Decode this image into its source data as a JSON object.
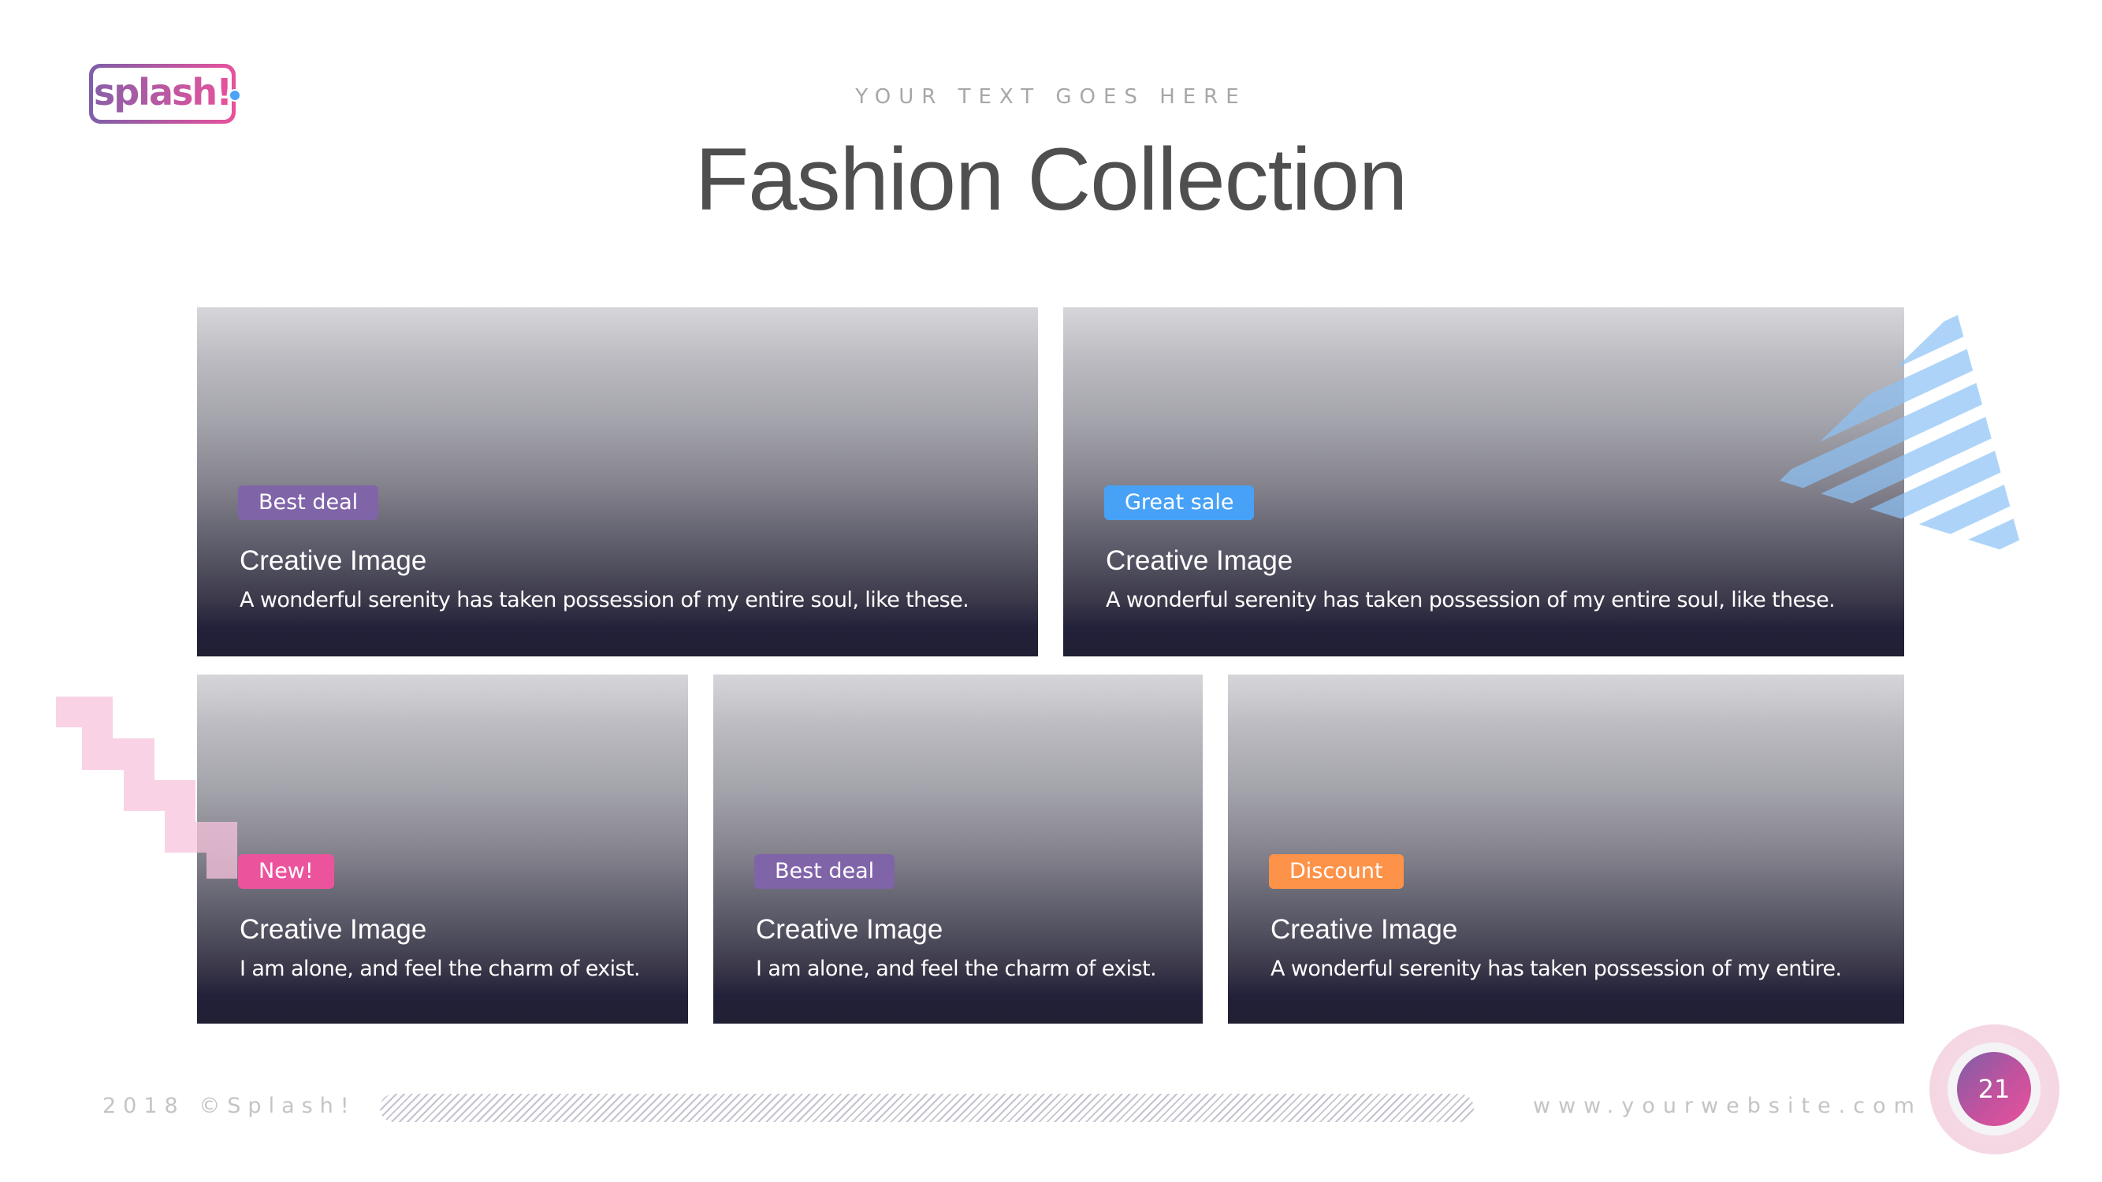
{
  "logo": {
    "text": "splash!"
  },
  "header": {
    "kicker": "YOUR TEXT GOES HERE",
    "title": "Fashion Collection"
  },
  "colors": {
    "purple": "#8064a8",
    "blue": "#47a2f7",
    "pink": "#ec539d",
    "orange": "#fd9249"
  },
  "cards": [
    {
      "badge": "Best deal",
      "badge_color": "#8064a8",
      "title": "Creative Image",
      "description": "A wonderful serenity has taken possession of my entire soul, like these."
    },
    {
      "badge": "Great sale",
      "badge_color": "#47a2f7",
      "title": "Creative Image",
      "description": "A wonderful serenity has taken possession of my entire soul, like these."
    },
    {
      "badge": "New!",
      "badge_color": "#ec539d",
      "title": "Creative Image",
      "description": "I am alone, and feel the charm of exist."
    },
    {
      "badge": "Best deal",
      "badge_color": "#8064a8",
      "title": "Creative Image",
      "description": "I am alone, and feel the charm of exist."
    },
    {
      "badge": "Discount",
      "badge_color": "#fd9249",
      "title": "Creative Image",
      "description": "A wonderful serenity has taken possession of my entire."
    }
  ],
  "footer": {
    "copyright": "2018 ©Splash!",
    "website": "www.yourwebsite.com",
    "page_number": "21"
  }
}
